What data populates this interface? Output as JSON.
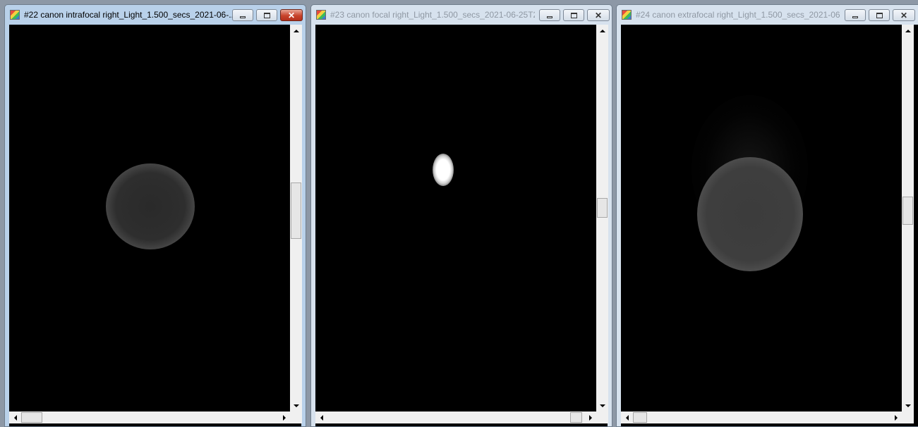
{
  "windows": [
    {
      "title": "#22 canon intrafocal right_Light_1.500_secs_2021-06-...",
      "active": true,
      "image": "intrafocal-star",
      "vscroll_position_pct": 43,
      "hscroll_position_pct": 0
    },
    {
      "title": "#23 canon focal right_Light_1.500_secs_2021-06-25T2...",
      "active": false,
      "image": "focal-star",
      "vscroll_position_pct": 48,
      "hscroll_position_pct": 100
    },
    {
      "title": "#24 canon extrafocal right_Light_1.500_secs_2021-06-...",
      "active": false,
      "image": "extrafocal-star",
      "vscroll_position_pct": 47,
      "hscroll_position_pct": 0
    }
  ],
  "icons": {
    "app": "pixinsight-image-icon",
    "minimize": "minimize-icon",
    "maximize": "maximize-icon",
    "close": "close-icon",
    "scroll_up": "arrow-up-icon",
    "scroll_down": "arrow-down-icon",
    "scroll_left": "arrow-left-icon",
    "scroll_right": "arrow-right-icon"
  },
  "colors": {
    "desktop": "#8d98a6",
    "active_close": "#c8432b",
    "image_background": "#000000",
    "inactive_title_text": "#8f98a3"
  }
}
